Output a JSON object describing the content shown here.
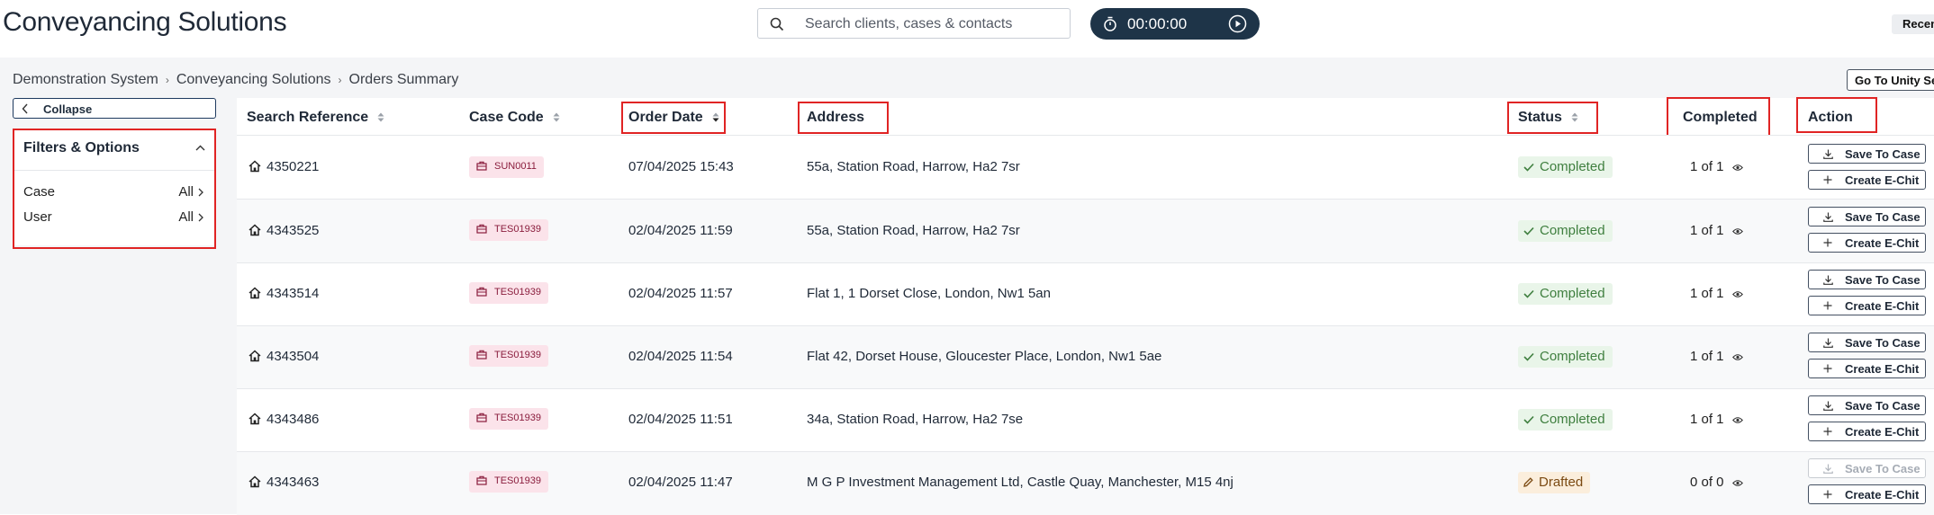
{
  "app": {
    "title": "Conveyancing Solutions"
  },
  "search": {
    "placeholder": "Search clients, cases & contacts",
    "icon": "search-icon"
  },
  "timer": {
    "value": "00:00:00",
    "icon": "stopwatch-icon",
    "play_icon": "play-icon"
  },
  "topbar": {
    "recent_label": "Recen"
  },
  "breadcrumb": [
    "Demonstration System",
    "Conveyancing Solutions",
    "Orders Summary"
  ],
  "toolbar": {
    "unity_search_label": "Go To Unity Sea"
  },
  "sidebar": {
    "collapse_label": "Collapse",
    "filters_title": "Filters & Options",
    "filters": [
      {
        "label": "Case",
        "value": "All"
      },
      {
        "label": "User",
        "value": "All"
      }
    ]
  },
  "table": {
    "columns": [
      "Search Reference",
      "Case Code",
      "Order Date",
      "Address",
      "Status",
      "Completed",
      "Action"
    ],
    "rows": [
      {
        "ref": "4350221",
        "case": "SUN0011",
        "date": "07/04/2025 15:43",
        "address": "55a, Station Road, Harrow, Ha2 7sr",
        "status": "Completed",
        "completed": "1 of 1",
        "save": "Save To Case",
        "echit": "Create E-Chit"
      },
      {
        "ref": "4343525",
        "case": "TES01939",
        "date": "02/04/2025 11:59",
        "address": "55a, Station Road, Harrow, Ha2 7sr",
        "status": "Completed",
        "completed": "1 of 1",
        "save": "Save To Case",
        "echit": "Create E-Chit"
      },
      {
        "ref": "4343514",
        "case": "TES01939",
        "date": "02/04/2025 11:57",
        "address": "Flat 1, 1 Dorset Close, London, Nw1 5an",
        "status": "Completed",
        "completed": "1 of 1",
        "save": "Save To Case",
        "echit": "Create E-Chit"
      },
      {
        "ref": "4343504",
        "case": "TES01939",
        "date": "02/04/2025 11:54",
        "address": "Flat 42, Dorset House, Gloucester Place, London, Nw1 5ae",
        "status": "Completed",
        "completed": "1 of 1",
        "save": "Save To Case",
        "echit": "Create E-Chit"
      },
      {
        "ref": "4343486",
        "case": "TES01939",
        "date": "02/04/2025 11:51",
        "address": "34a, Station Road, Harrow, Ha2 7se",
        "status": "Completed",
        "completed": "1 of 1",
        "save": "Save To Case",
        "echit": "Create E-Chit"
      },
      {
        "ref": "4343463",
        "case": "TES01939",
        "date": "02/04/2025 11:47",
        "address": "M G P Investment Management Ltd, Castle Quay, Manchester, M15 4nj",
        "status": "Drafted",
        "completed": "0 of 0",
        "save": "Save To Case",
        "echit": "Create E-Chit"
      }
    ]
  },
  "colors": {
    "accent": "#1e3448",
    "highlight": "#e02424",
    "completed": "#3f7f3f",
    "drafted": "#7b4a12",
    "case_badge": "#fbe3ea"
  }
}
